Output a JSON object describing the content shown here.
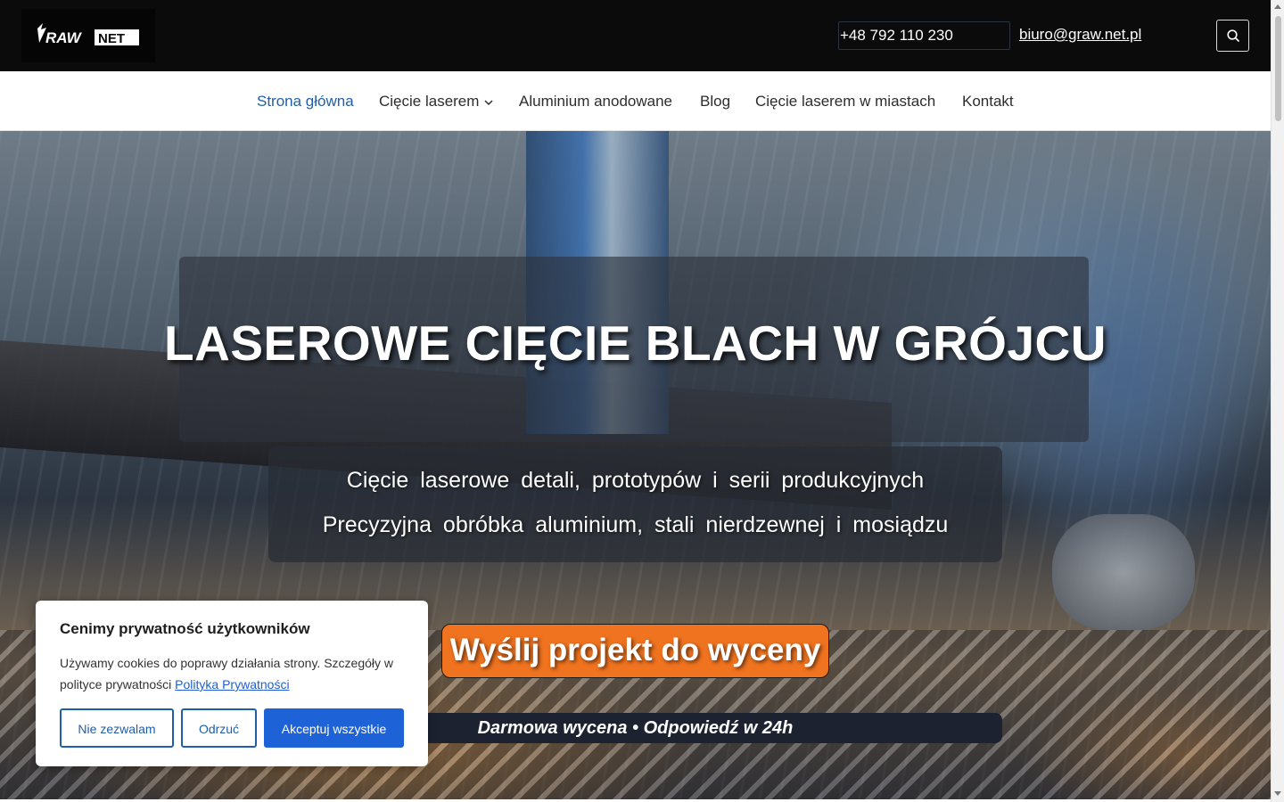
{
  "header": {
    "logo_text": "GRAWNET",
    "phone": "+48 792 110 230",
    "email": "biuro@graw.net.pl",
    "search_icon": "search-icon"
  },
  "nav": {
    "items": [
      {
        "label": "Strona główna",
        "active": true
      },
      {
        "label": "Cięcie laserem",
        "has_dropdown": true
      },
      {
        "label": "Aluminium anodowane"
      },
      {
        "label": "Blog"
      },
      {
        "label": "Cięcie laserem w miastach"
      },
      {
        "label": "Kontakt"
      }
    ],
    "active_color": "#1f5fa8"
  },
  "hero": {
    "title": "LASEROWE CIĘCIE BLACH W GRÓJCU",
    "subtitle_line1": "Cięcie laserowe detali, prototypów i serii produkcyjnych",
    "subtitle_line2": "Precyzyjna obróbka aluminium, stali nierdzewnej i mosiądzu",
    "cta_label": "Wyślij projekt do wyceny",
    "cta_color": "#f0731f",
    "badge": "Darmowa wycena • Odpowiedź w 24h"
  },
  "cookie_banner": {
    "title": "Cenimy prywatność użytkowników",
    "text": "Używamy cookies do poprawy działania strony. Szczegóły w polityce prywatności",
    "link": "Polityka Prywatności",
    "buttons": {
      "deny": "Nie zezwalam",
      "reject": "Odrzuć",
      "accept_all": "Akceptuj wszystkie"
    },
    "accent_color": "#1d62d6"
  }
}
